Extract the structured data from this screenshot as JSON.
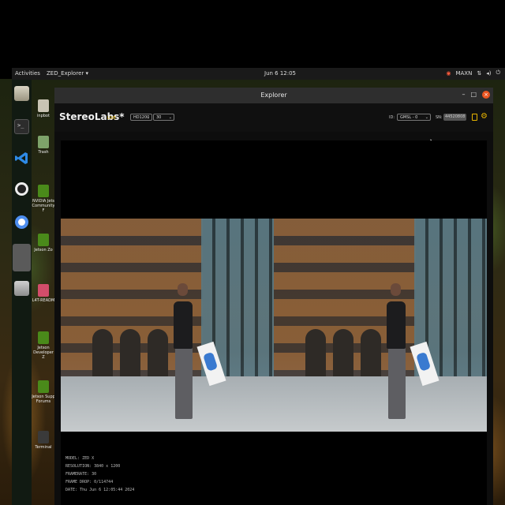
{
  "topbar": {
    "activities": "Activities",
    "app_menu": "ZED_Explorer ▾",
    "clock": "Jun 6 12:05",
    "status_items": [
      "MAXN"
    ]
  },
  "desktop_icons": [
    {
      "label": "inpbot"
    },
    {
      "label": "Trash"
    },
    {
      "label": "NVIDIA Jets Community F"
    },
    {
      "label": "Jetson Zo"
    },
    {
      "label": "L4T-READM"
    },
    {
      "label": "Jetson Developer Z"
    },
    {
      "label": "Jetson Supp Forums"
    },
    {
      "label": "Terminal"
    }
  ],
  "window": {
    "title": "Explorer",
    "minimize": "–",
    "maximize": "□",
    "close": "×"
  },
  "toolbar": {
    "brand": "StereoLabs*",
    "live_label": "LIVE",
    "resolution": "HD1200",
    "fps": "30",
    "id_label": "ID:",
    "camera": "GMSL - 0",
    "sn_label": "SN:",
    "sn_value": "44520808"
  },
  "info": {
    "lines": [
      "MODEL: ZED X",
      "RESOLUTION: 3840 x 1200",
      "FRAMERATE: 30",
      "FRAME DROP: 0/114744",
      "DATE: Thu Jun 6 12:05:44 2024"
    ]
  },
  "colors": {
    "accent": "#e8b400",
    "close": "#e95420",
    "topbar": "#1a1a1a"
  }
}
